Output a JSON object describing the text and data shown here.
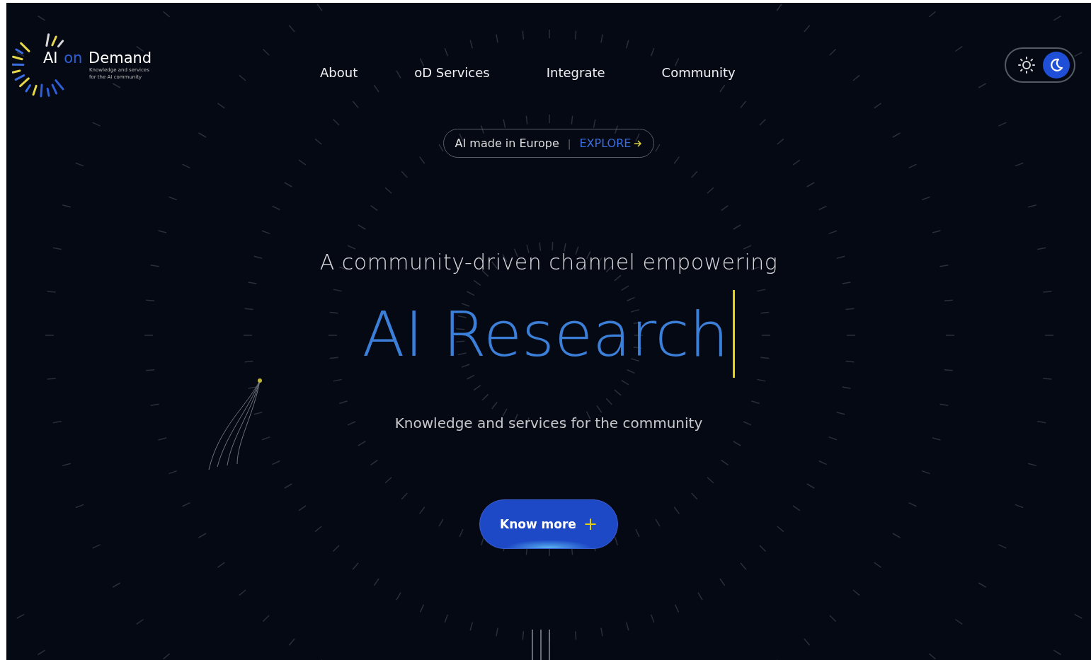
{
  "logo": {
    "title_first": "AI",
    "title_accent": "on",
    "title_last": "Demand",
    "tagline_line1": "Knowledge and services",
    "tagline_line2": "for the AI community"
  },
  "nav": [
    {
      "label": "About"
    },
    {
      "label": "oD Services"
    },
    {
      "label": "Integrate"
    },
    {
      "label": "Community"
    }
  ],
  "theme_toggle": [
    {
      "kind": "light",
      "selected": false
    },
    {
      "kind": "dark",
      "selected": true
    }
  ],
  "announcement": {
    "text": "AI made in Europe",
    "separator": "|",
    "link": "EXPLORE"
  },
  "hero": {
    "lead": "A community-driven channel empowering",
    "headline": "AI Research",
    "subtitle": "Knowledge and services for the community"
  },
  "cta": {
    "label": "Know more",
    "icon": "+"
  }
}
